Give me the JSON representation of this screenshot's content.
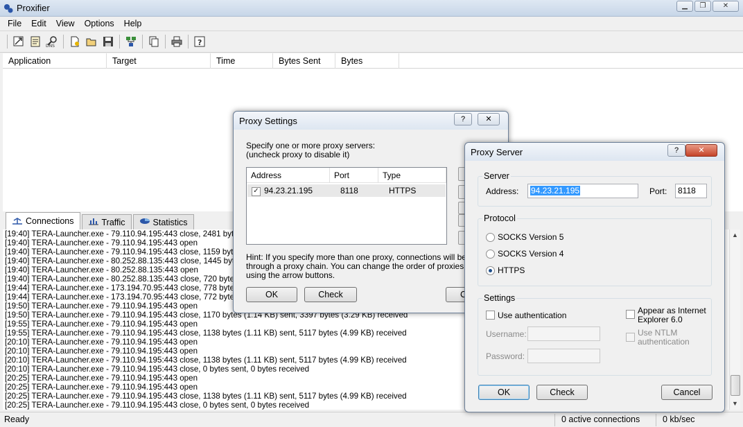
{
  "main": {
    "title": "Proxifier",
    "menu": [
      "File",
      "Edit",
      "View",
      "Options",
      "Help"
    ],
    "toolbar_icons": [
      "proxy-servers-icon",
      "proxification-rules-icon",
      "name-resolution-icon",
      "new-profile-icon",
      "open-profile-icon",
      "save-profile-icon",
      "advanced-icon",
      "copy-icon",
      "print-icon",
      "help-icon"
    ],
    "conn_columns": [
      "Application",
      "Target",
      "Time",
      "Bytes Sent",
      "Bytes Received"
    ],
    "tabs": [
      "Connections",
      "Traffic",
      "Statistics"
    ],
    "log": [
      "[19:40] TERA-Launcher.exe - 79.110.94.195:443 close, 2481 bytes (2",
      "[19:40] TERA-Launcher.exe - 79.110.94.195:443 open",
      "[19:40] TERA-Launcher.exe - 79.110.94.195:443 close, 1159 bytes (1",
      "[19:40] TERA-Launcher.exe - 80.252.88.135:443 close, 1445 bytes (1",
      "[19:40] TERA-Launcher.exe - 80.252.88.135:443 open",
      "[19:40] TERA-Launcher.exe - 80.252.88.135:443 close, 720 bytes sent",
      "[19:44] TERA-Launcher.exe - 173.194.70.95:443 close, 778 bytes sent",
      "[19:44] TERA-Launcher.exe - 173.194.70.95:443 close, 772 bytes sent",
      "[19:50] TERA-Launcher.exe - 79.110.94.195:443 open",
      "[19:50] TERA-Launcher.exe - 79.110.94.195:443 close, 1170 bytes (1.14 KB) sent, 3397 bytes (3.29 KB) received",
      "[19:55] TERA-Launcher.exe - 79.110.94.195:443 open",
      "[19:55] TERA-Launcher.exe - 79.110.94.195:443 close, 1138 bytes (1.11 KB) sent, 5117 bytes (4.99 KB) received",
      "[20:10] TERA-Launcher.exe - 79.110.94.195:443 open",
      "[20:10] TERA-Launcher.exe - 79.110.94.195:443 open",
      "[20:10] TERA-Launcher.exe - 79.110.94.195:443 close, 1138 bytes (1.11 KB) sent, 5117 bytes (4.99 KB) received",
      "[20:10] TERA-Launcher.exe - 79.110.94.195:443 close, 0 bytes sent, 0 bytes received",
      "[20:25] TERA-Launcher.exe - 79.110.94.195:443 open",
      "[20:25] TERA-Launcher.exe - 79.110.94.195:443 open",
      "[20:25] TERA-Launcher.exe - 79.110.94.195:443 close, 1138 bytes (1.11 KB) sent, 5117 bytes (4.99 KB) received",
      "[20:25] TERA-Launcher.exe - 79.110.94.195:443 close, 0 bytes sent, 0 bytes received"
    ],
    "status": {
      "text": "Ready",
      "connections": "0 active connections",
      "speed": "0 kb/sec"
    }
  },
  "proxy_settings": {
    "title": "Proxy Settings",
    "help_button": "?",
    "close_button": "✕",
    "instructions_line1": "Specify one or more proxy servers:",
    "instructions_line2": "(uncheck proxy to disable it)",
    "columns": [
      "Address",
      "Port",
      "Type"
    ],
    "rows": [
      {
        "checked": true,
        "address": "94.23.21.195",
        "port": "8118",
        "type": "HTTPS"
      }
    ],
    "hint_line1": "Hint: If you specify more than one proxy, connections will be establ",
    "hint_line2": "through a proxy chain. You can change the order of proxies in the c",
    "hint_line3": "using the arrow buttons.",
    "ok_button": "OK",
    "check_button": "Check",
    "cancel_button_partial": "C"
  },
  "proxy_server": {
    "title": "Proxy Server",
    "help_button": "?",
    "close_button": "✕",
    "server_group": "Server",
    "address_label": "Address:",
    "address_value": "94.23.21.195",
    "port_label": "Port:",
    "port_value": "8118",
    "protocol_group": "Protocol",
    "protocols": [
      {
        "label": "SOCKS Version 5",
        "selected": false
      },
      {
        "label": "SOCKS Version 4",
        "selected": false
      },
      {
        "label": "HTTPS",
        "selected": true
      }
    ],
    "settings_group": "Settings",
    "use_auth_label": "Use authentication",
    "appear_ie_line1": "Appear as Internet",
    "appear_ie_line2": "Explorer 6.0",
    "use_ntlm_line1": "Use NTLM",
    "use_ntlm_line2": "authentication",
    "username_label": "Username:",
    "password_label": "Password:",
    "ok_button": "OK",
    "check_button": "Check",
    "cancel_button": "Cancel"
  },
  "colors": {
    "selection": "#3399ff",
    "close_red": "#c5442a"
  }
}
